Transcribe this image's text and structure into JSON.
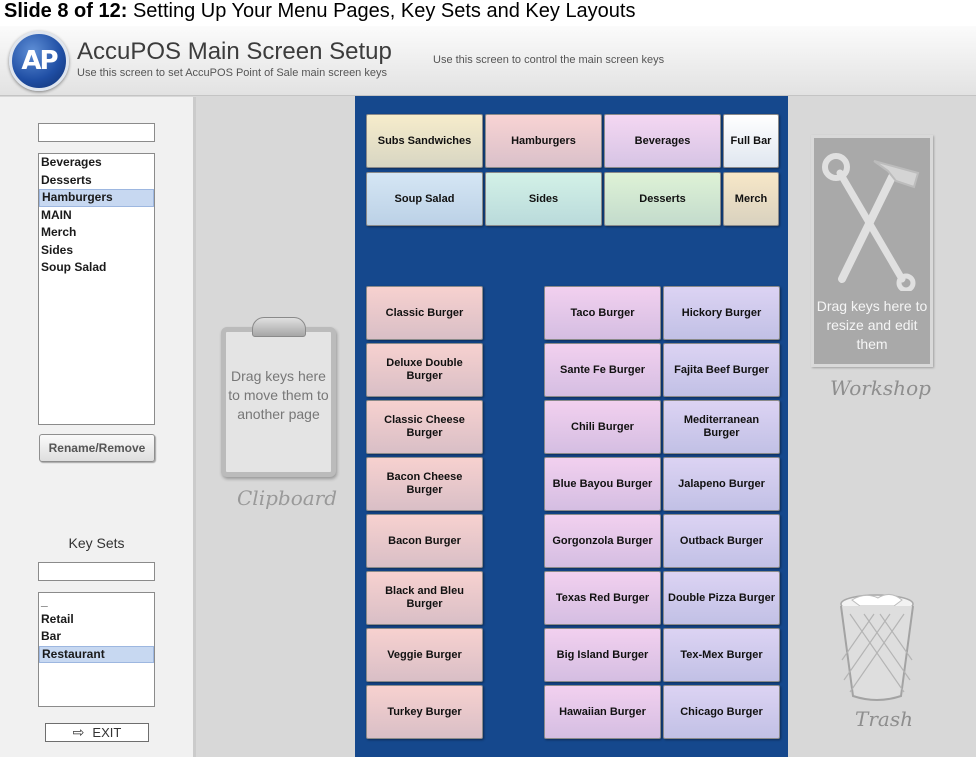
{
  "slide": {
    "number": "Slide 8 of 12:",
    "title": "Setting Up Your Menu Pages, Key Sets and Key Layouts"
  },
  "header": {
    "logo_text": "AP",
    "title": "AccuPOS Main Screen Setup",
    "subtitle": "Use this screen to set AccuPOS Point of Sale main screen keys",
    "note": "Use this screen to control the main screen keys"
  },
  "pages": {
    "input_value": "",
    "items": [
      "Beverages",
      "Desserts",
      "Hamburgers",
      "MAIN",
      "Merch",
      "Sides",
      "Soup Salad"
    ],
    "selected": "Hamburgers",
    "rename_label": "Rename/Remove"
  },
  "keysets": {
    "label": "Key Sets",
    "input_value": "",
    "items": [
      "_",
      "Retail",
      "Bar",
      "Restaurant"
    ],
    "selected": "Restaurant"
  },
  "exit": {
    "label": "EXIT",
    "icon": "exit-arrow-icon"
  },
  "clipboard": {
    "text": "Drag keys here to move them to another page",
    "label": "Clipboard",
    "icon": "clipboard-icon"
  },
  "workshop": {
    "text": "Drag keys here to resize and edit them",
    "label": "Workshop",
    "icon": "hammer-wrench-icon"
  },
  "trash": {
    "label": "Trash",
    "icon": "trash-basket-icon"
  },
  "category_keys": [
    {
      "label": "Subs Sandwiches",
      "color": "#f6eccb"
    },
    {
      "label": "Hamburgers",
      "color": "#f8d3d3"
    },
    {
      "label": "Beverages",
      "color": "#f4d7f2"
    },
    {
      "label": "Full Bar",
      "color": "#ffffff"
    },
    {
      "label": "Soup Salad",
      "color": "#d5e6f4"
    },
    {
      "label": "Sides",
      "color": "#d3f1e7"
    },
    {
      "label": "Desserts",
      "color": "#def2d6"
    },
    {
      "label": "Merch",
      "color": "#f7e7c7"
    }
  ],
  "burger_keys": {
    "left_color": "#f7d1cf",
    "pink_color": "#f2d0ef",
    "purple_color": "#dcd3f3",
    "left": [
      "Classic Burger",
      "Deluxe Double Burger",
      "Classic Cheese Burger",
      "Bacon Cheese Burger",
      "Bacon Burger",
      "Black and Bleu Burger",
      "Veggie Burger",
      "Turkey Burger"
    ],
    "middle": [
      "Taco Burger",
      "Sante Fe Burger",
      "Chili Burger",
      "Blue Bayou Burger",
      "Gorgonzola Burger",
      "Texas Red Burger",
      "Big Island Burger",
      "Hawaiian Burger"
    ],
    "right": [
      "Hickory Burger",
      "Fajita Beef Burger",
      "Mediterranean Burger",
      "Jalapeno Burger",
      "Outback Burger",
      "Double Pizza Burger",
      "Tex-Mex Burger",
      "Chicago Burger"
    ]
  }
}
